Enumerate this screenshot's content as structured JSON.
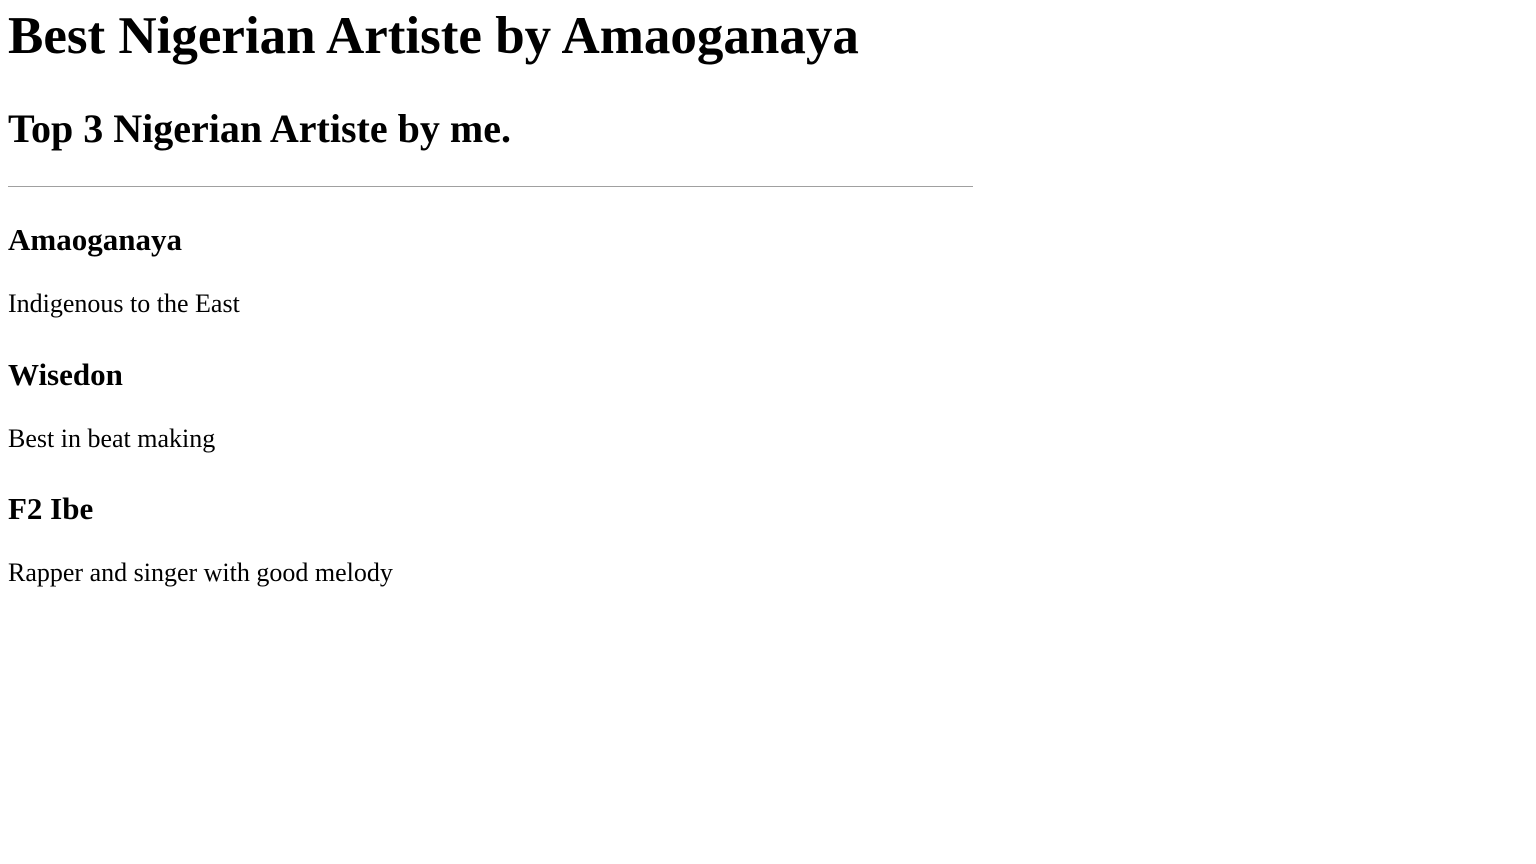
{
  "header": {
    "title": "Best Nigerian Artiste by Amaoganaya",
    "subtitle": "Top 3 Nigerian Artiste by me."
  },
  "artists": [
    {
      "name": "Amaoganaya",
      "description": "Indigenous to the East"
    },
    {
      "name": "Wisedon",
      "description": "Best in beat making"
    },
    {
      "name": "F2 Ibe",
      "description": "Rapper and singer with good melody"
    }
  ]
}
